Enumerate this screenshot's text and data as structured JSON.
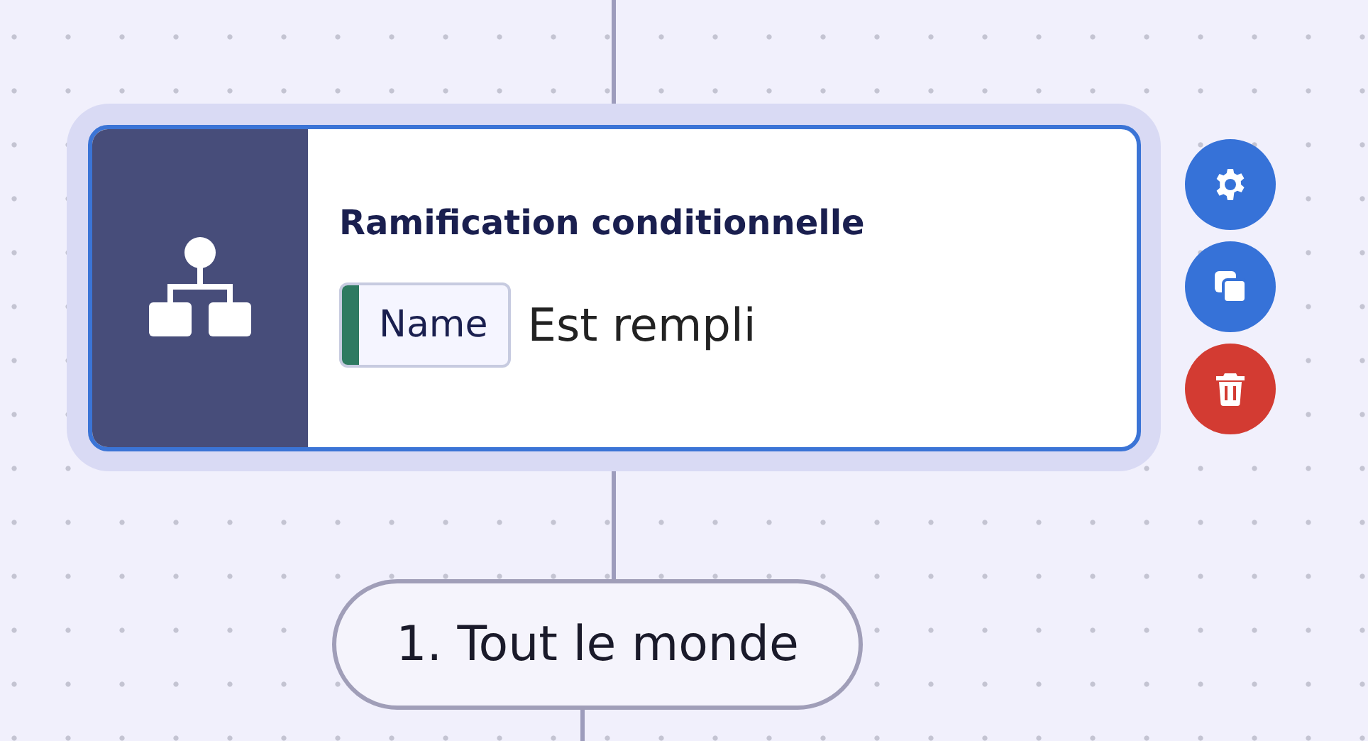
{
  "node": {
    "title": "Ramification conditionnelle",
    "selected": true,
    "condition": {
      "field": "Name",
      "operator": "Est rempli"
    },
    "actions": [
      {
        "kind": "settings"
      },
      {
        "kind": "duplicate"
      },
      {
        "kind": "delete"
      }
    ]
  },
  "branches": [
    {
      "label": "1. Tout le monde"
    }
  ]
}
